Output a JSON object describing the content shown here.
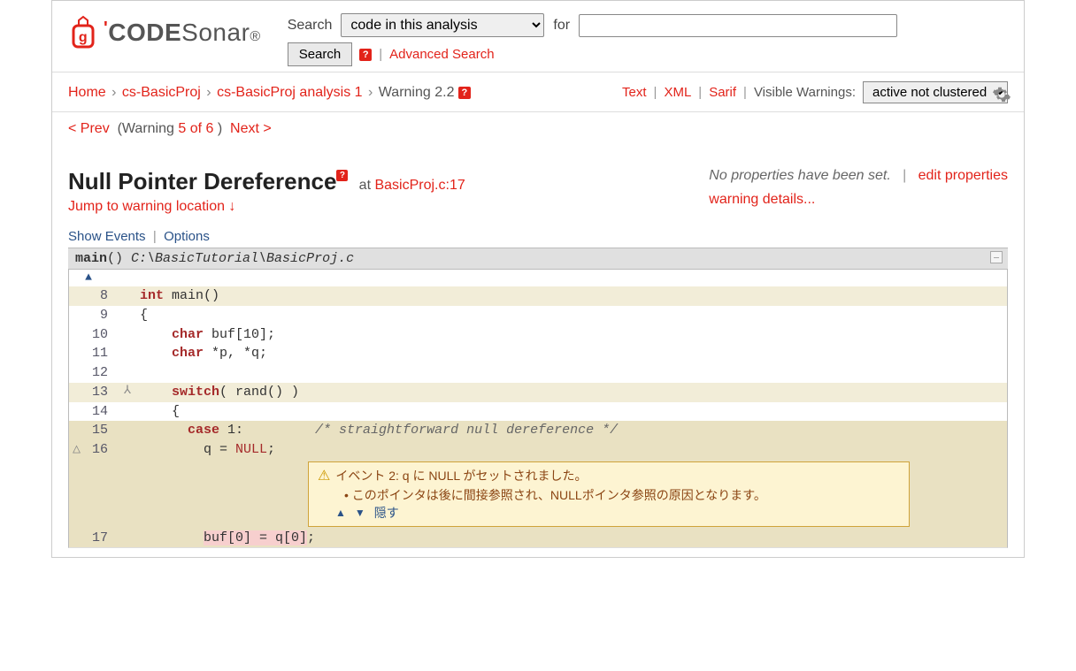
{
  "header": {
    "search_label": "Search",
    "search_scope_selected": "code in this analysis",
    "for_label": "for",
    "for_value": "",
    "search_button": "Search",
    "advanced_search": "Advanced Search"
  },
  "breadcrumb": {
    "home": "Home",
    "proj": "cs-BasicProj",
    "analysis": "cs-BasicProj analysis 1",
    "warning": "Warning 2.2"
  },
  "format_links": {
    "text": "Text",
    "xml": "XML",
    "sarif": "Sarif",
    "visible_warnings_label": "Visible Warnings:",
    "visible_warnings_selected": "active not clustered"
  },
  "pager": {
    "prev": "< Prev",
    "status_open": "(Warning ",
    "status_mid": "5 of 6",
    "status_close": " )",
    "next": "Next >"
  },
  "warning": {
    "title": "Null Pointer Dereference",
    "at_label": "at",
    "location": "BasicProj.c:17",
    "jump": "Jump to warning location ↓",
    "no_props": "No properties have been set.",
    "edit_props": "edit properties",
    "details": "warning details..."
  },
  "opts": {
    "show_events": "Show Events",
    "options": "Options"
  },
  "code": {
    "func": "main",
    "func_sig": "()",
    "path": " C:\\BasicTutorial\\BasicProj.c",
    "lines": {
      "l8_a": "int",
      "l8_b": " main()",
      "l9": "{",
      "l10_a": "    char",
      "l10_b": " buf[10];",
      "l11_a": "    char",
      "l11_b": " *p, *q;",
      "l12": "",
      "l13_a": "    switch",
      "l13_b": "( rand() )",
      "l14": "    {",
      "l15_a": "      case",
      "l15_b": " 1:         ",
      "l15_c": "/* straightforward null dereference */",
      "l16_a": "        q = ",
      "l16_b": "NULL",
      "l16_c": ";",
      "l17_a": "        ",
      "l17_b": "buf[0] = q[0]",
      "l17_c": ";"
    },
    "line_numbers": {
      "n8": "8",
      "n9": "9",
      "n10": "10",
      "n11": "11",
      "n12": "12",
      "n13": "13",
      "n14": "14",
      "n15": "15",
      "n16": "16",
      "n17": "17"
    }
  },
  "event": {
    "title": "イベント 2: q に NULL がセットされました。",
    "bullet": "•  このポインタは後に間接参照され、NULLポインタ参照の原因となります。",
    "hide": "隠す"
  }
}
